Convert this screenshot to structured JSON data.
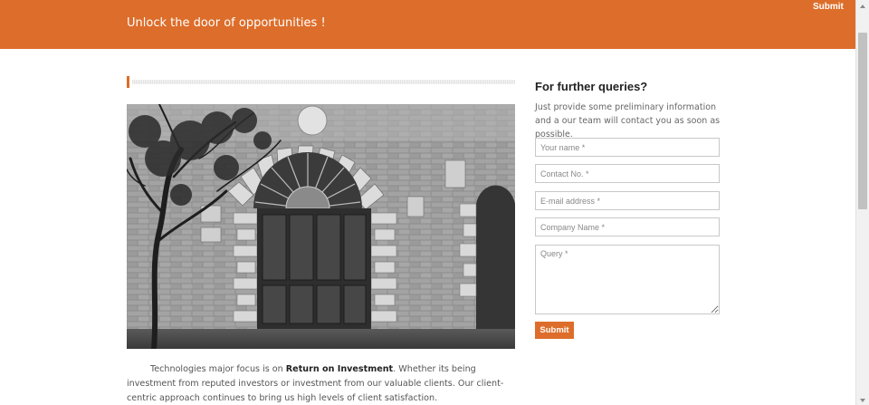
{
  "header": {
    "tagline": "Unlock the door of opportunities !",
    "submit_label": "Submit",
    "background_color": "#dd6d2a"
  },
  "about": {
    "lead": "Technologies major focus is on ",
    "highlight": "Return on Investment",
    "rest": ". Whether its being investment from reputed investors or investment from our valuable clients. Our client-centric approach continues to bring us high levels of client satisfaction."
  },
  "image": {
    "icon": "arched-doorway-photo"
  },
  "form": {
    "title": "For further queries?",
    "description": "Just provide some preliminary information and a our team will contact you as soon as possible.",
    "fields": {
      "name_placeholder": "Your name *",
      "contact_placeholder": "Contact No. *",
      "email_placeholder": "E-mail address *",
      "company_placeholder": "Company Name *",
      "query_placeholder": "Query *"
    },
    "submit_label": "Submit"
  }
}
